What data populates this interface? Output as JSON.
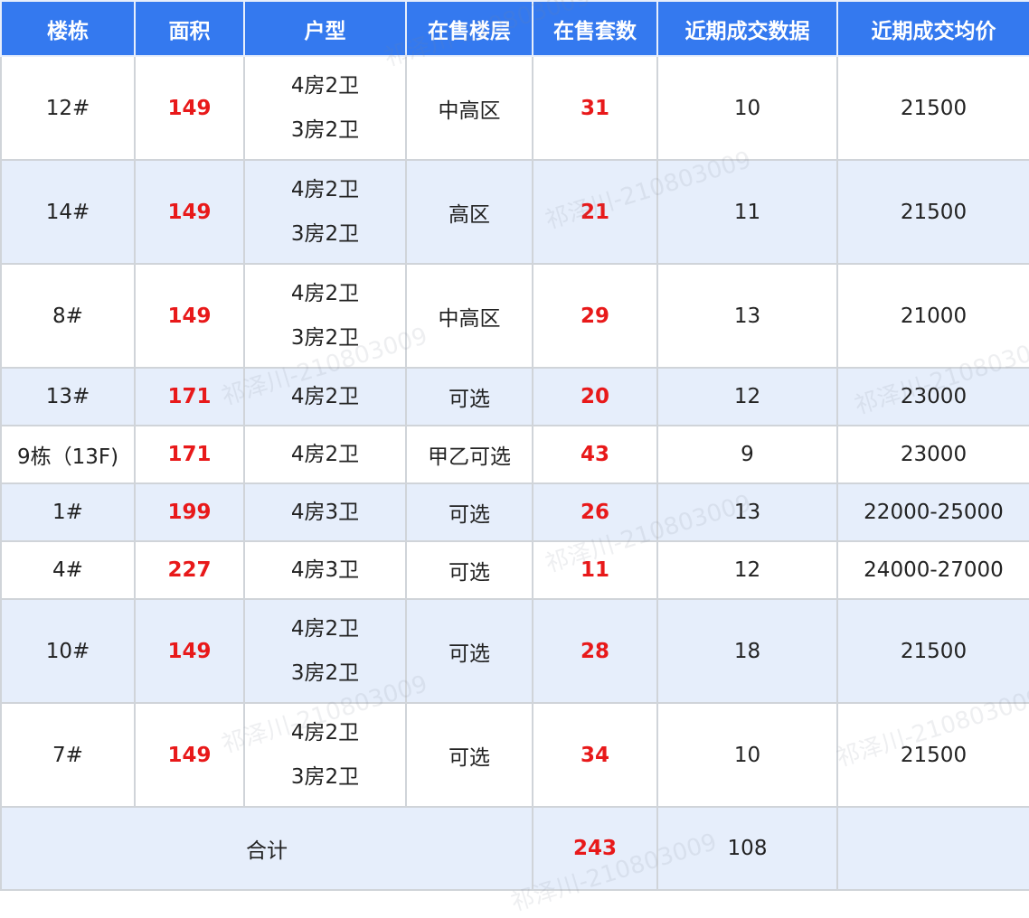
{
  "headers": [
    "楼栋",
    "面积",
    "户型",
    "在售楼层",
    "在售套数",
    "近期成交数据",
    "近期成交均价"
  ],
  "rows": [
    {
      "building": "12#",
      "area": "149",
      "types": [
        "4房2卫",
        "3房2卫"
      ],
      "floors": "中高区",
      "units": "31",
      "deals": "10",
      "price": "21500"
    },
    {
      "building": "14#",
      "area": "149",
      "types": [
        "4房2卫",
        "3房2卫"
      ],
      "floors": "高区",
      "units": "21",
      "deals": "11",
      "price": "21500"
    },
    {
      "building": "8#",
      "area": "149",
      "types": [
        "4房2卫",
        "3房2卫"
      ],
      "floors": "中高区",
      "units": "29",
      "deals": "13",
      "price": "21000"
    },
    {
      "building": "13#",
      "area": "171",
      "types": [
        "4房2卫"
      ],
      "floors": "可选",
      "units": "20",
      "deals": "12",
      "price": "23000"
    },
    {
      "building": "9栋（13F)",
      "area": "171",
      "types": [
        "4房2卫"
      ],
      "floors": "甲乙可选",
      "units": "43",
      "deals": "9",
      "price": "23000"
    },
    {
      "building": "1#",
      "area": "199",
      "types": [
        "4房3卫"
      ],
      "floors": "可选",
      "units": "26",
      "deals": "13",
      "price": "22000-25000"
    },
    {
      "building": "4#",
      "area": "227",
      "types": [
        "4房3卫"
      ],
      "floors": "可选",
      "units": "11",
      "deals": "12",
      "price": "24000-27000"
    },
    {
      "building": "10#",
      "area": "149",
      "types": [
        "4房2卫",
        "3房2卫"
      ],
      "floors": "可选",
      "units": "28",
      "deals": "18",
      "price": "21500"
    },
    {
      "building": "7#",
      "area": "149",
      "types": [
        "4房2卫",
        "3房2卫"
      ],
      "floors": "可选",
      "units": "34",
      "deals": "10",
      "price": "21500"
    }
  ],
  "total": {
    "label": "合计",
    "units": "243",
    "deals": "108"
  },
  "watermark": "祁泽川-210803009",
  "colors": {
    "header_bg": "#3479ef",
    "stripe_bg": "#e6eefb",
    "highlight": "#e8191a"
  }
}
